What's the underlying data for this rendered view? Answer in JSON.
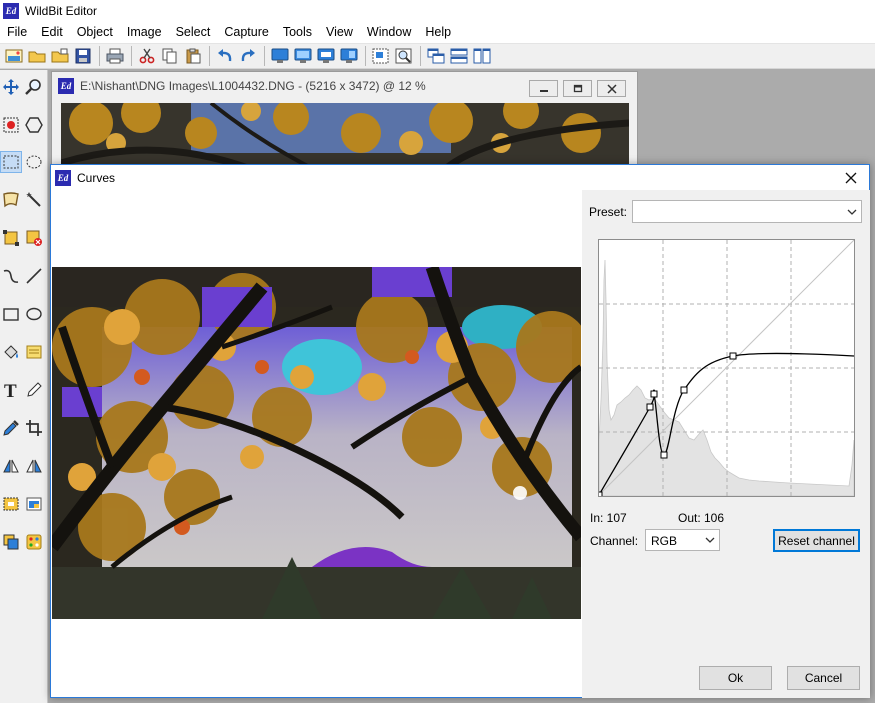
{
  "app": {
    "title": "WildBit Editor",
    "logo_text": "Ed"
  },
  "menu": [
    "File",
    "Edit",
    "Object",
    "Image",
    "Select",
    "Capture",
    "Tools",
    "View",
    "Window",
    "Help"
  ],
  "image_window": {
    "title": "E:\\Nishant\\DNG Images\\L1004432.DNG - (5216 x 3472) @ 12  %"
  },
  "curves": {
    "title": "Curves",
    "preset_label": "Preset:",
    "preset_value": "",
    "in_label": "In: 107",
    "out_label": "Out: 106",
    "channel_label": "Channel:",
    "channel_value": "RGB",
    "reset_label": "Reset channel",
    "ok_label": "Ok",
    "cancel_label": "Cancel",
    "control_points": [
      [
        0,
        0
      ],
      [
        51,
        88
      ],
      [
        55,
        101
      ],
      [
        65,
        40
      ],
      [
        85,
        105
      ],
      [
        134,
        139
      ],
      [
        255,
        139
      ]
    ]
  },
  "colors": {
    "accent": "#0078d7",
    "dialog_border": "#2b79d8",
    "logo": "#2b2bb0"
  }
}
